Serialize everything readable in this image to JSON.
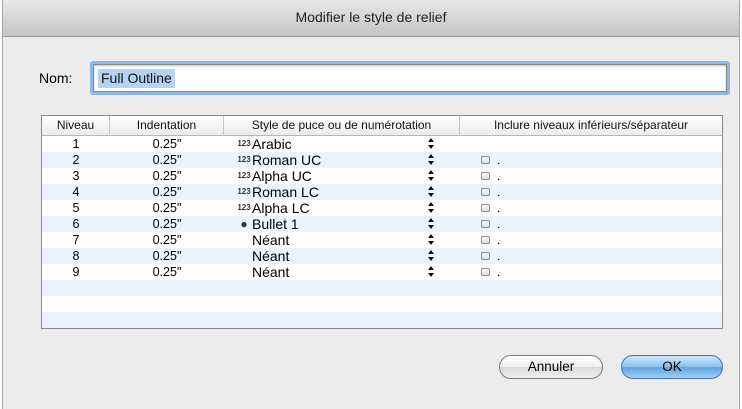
{
  "window": {
    "title": "Modifier le style de relief"
  },
  "name_field": {
    "label": "Nom:",
    "value": "Full Outline"
  },
  "table": {
    "headers": [
      "Niveau",
      "Indentation",
      "Style de puce ou de numérotation",
      "Inclure niveaux inférieurs/séparateur"
    ],
    "rows": [
      {
        "level": "1",
        "indent": "0.25\"",
        "icon": "123",
        "style": "Arabic",
        "include": false,
        "separator": ""
      },
      {
        "level": "2",
        "indent": "0.25\"",
        "icon": "123",
        "style": "Roman UC",
        "include": true,
        "separator": "."
      },
      {
        "level": "3",
        "indent": "0.25\"",
        "icon": "123",
        "style": "Alpha UC",
        "include": true,
        "separator": "."
      },
      {
        "level": "4",
        "indent": "0.25\"",
        "icon": "123",
        "style": "Roman LC",
        "include": true,
        "separator": "."
      },
      {
        "level": "5",
        "indent": "0.25\"",
        "icon": "123",
        "style": "Alpha LC",
        "include": true,
        "separator": "."
      },
      {
        "level": "6",
        "indent": "0.25\"",
        "icon": "●",
        "style": "Bullet 1",
        "include": true,
        "separator": "."
      },
      {
        "level": "7",
        "indent": "0.25\"",
        "icon": "",
        "style": "Néant",
        "include": true,
        "separator": "."
      },
      {
        "level": "8",
        "indent": "0.25\"",
        "icon": "",
        "style": "Néant",
        "include": true,
        "separator": "."
      },
      {
        "level": "9",
        "indent": "0.25\"",
        "icon": "",
        "style": "Néant",
        "include": true,
        "separator": "."
      }
    ]
  },
  "buttons": {
    "cancel": "Annuler",
    "ok": "OK"
  },
  "colors": {
    "default_button": "#6aaee8",
    "selection": "#b5d3f6",
    "row_alt": "#edf3fe",
    "focus_ring": "#8cb7e6"
  }
}
